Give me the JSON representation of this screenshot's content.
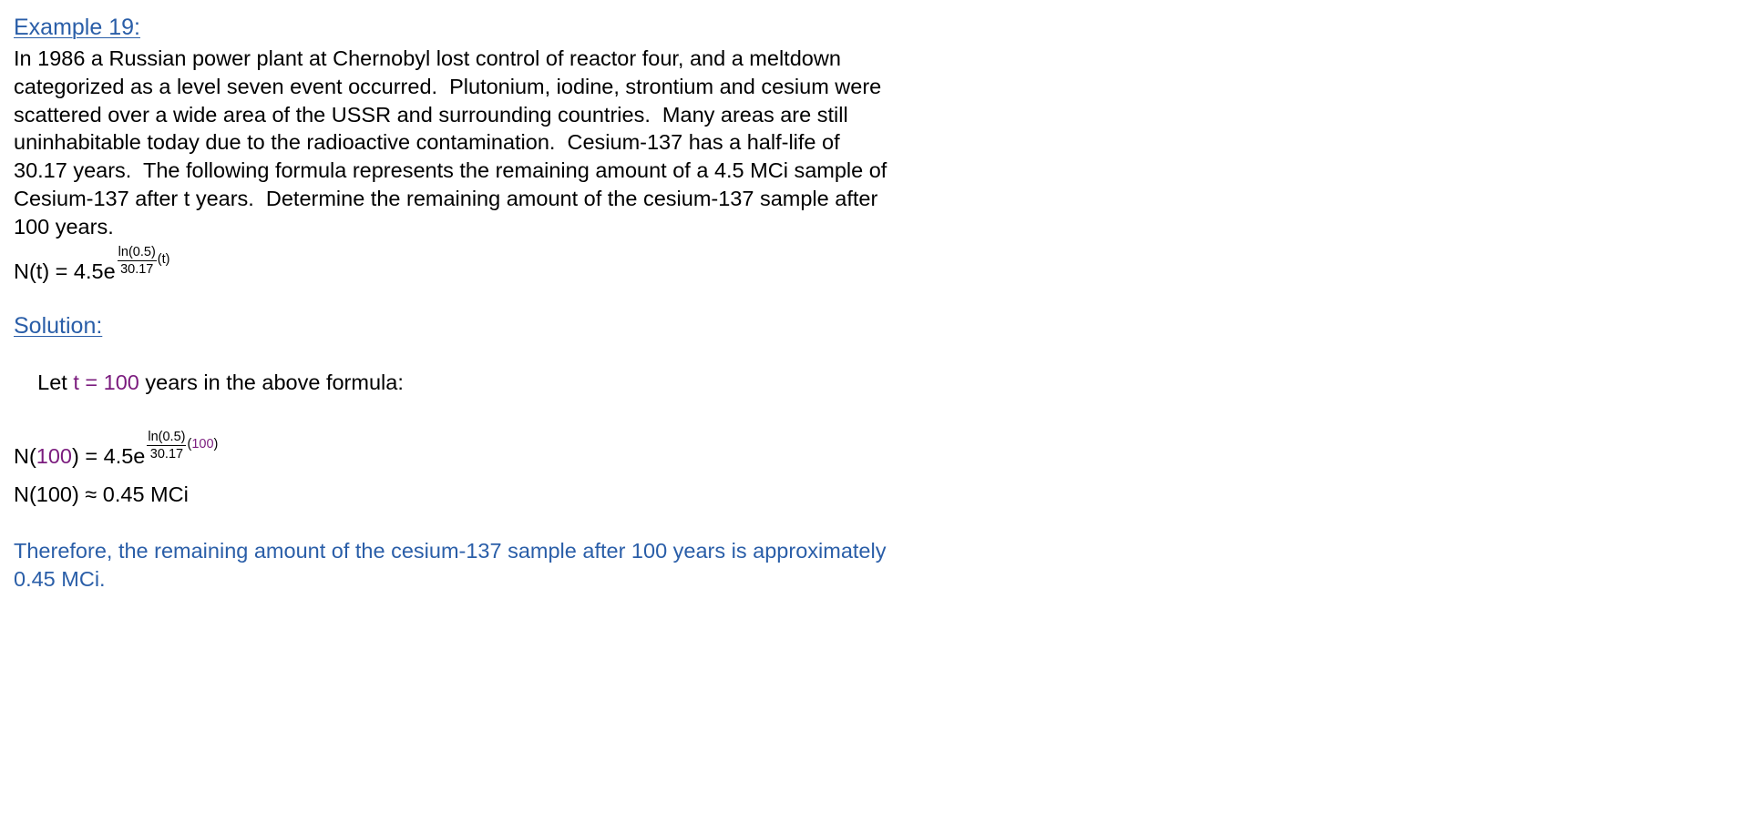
{
  "example": {
    "heading": "Example 19:",
    "problem_lines": [
      "In 1986 a Russian power plant at Chernobyl lost control of reactor four, and a meltdown",
      "categorized as a level seven event occurred.  Plutonium, iodine, strontium and cesium were",
      "scattered over a wide area of the USSR and surrounding countries.  Many areas are still",
      "uninhabitable today due to the radioactive contamination.  Cesium-137 has a half-life of",
      "30.17 years.  The following formula represents the remaining amount of a 4.5 MCi sample of",
      "Cesium-137 after t years.  Determine the remaining amount of the cesium-137 sample after",
      "100 years."
    ],
    "formula": {
      "lhs": "N(t) = 4.5e",
      "numerator": "ln(0.5)",
      "denominator": "30.17",
      "multiplier": "(t)"
    }
  },
  "solution": {
    "heading": "Solution:",
    "let_prefix": "Let ",
    "let_value": "t = 100",
    "let_suffix": " years in the above formula:",
    "substituted": {
      "lhs_prefix": "N(",
      "lhs_value": "100",
      "lhs_suffix": ") = 4.5e",
      "numerator": "ln(0.5)",
      "denominator": "30.17",
      "multiplier_open": "(",
      "multiplier_value": "100",
      "multiplier_close": ")"
    },
    "result": "N(100) ≈ 0.45 MCi",
    "conclusion_lines": [
      "Therefore, the remaining amount of the cesium-137 sample after 100 years is approximately",
      "0.45 MCi."
    ]
  },
  "colors": {
    "heading_blue": "#2a5ea8",
    "substitution_purple": "#7b1c7e",
    "body_text": "#000000",
    "background": "#ffffff"
  }
}
